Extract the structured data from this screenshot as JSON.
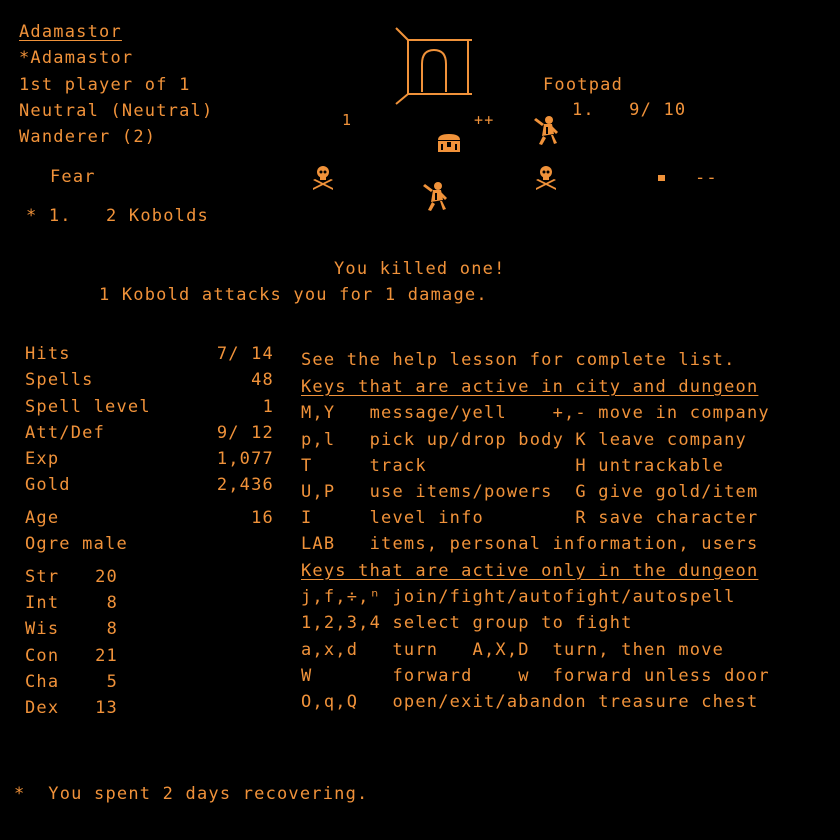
{
  "colors": {
    "text": "#f0923a",
    "background": "#000000"
  },
  "character": {
    "name": "Adamastor",
    "title": "*Adamastor",
    "player": "1st player of 1",
    "alignment": "Neutral (Neutral)",
    "class": "Wanderer (2)",
    "condition": "Fear"
  },
  "group": {
    "line": "* 1.   2 Kobolds"
  },
  "view": {
    "monster_name": "Footpad",
    "monster_count": "1.   9/ 10",
    "marker_one": "1",
    "marker_plus": "++",
    "marker_dash": "--",
    "icons": [
      "archway-door-icon",
      "treasure-chest-icon",
      "kobold-icon",
      "skull-crossbones-icon",
      "skull-crossbones-icon",
      "kobold-icon",
      "compass-marker-icon"
    ]
  },
  "messages": {
    "line1": "You killed one!",
    "line2": "1 Kobold attacks you for 1 damage.",
    "footer": "*  You spent 2 days recovering."
  },
  "stats": {
    "rows": [
      {
        "label": "Hits",
        "value": "7/ 14"
      },
      {
        "label": "Spells",
        "value": "48"
      },
      {
        "label": "Spell level",
        "value": "1"
      },
      {
        "label": "Att/Def",
        "value": "9/ 12"
      },
      {
        "label": "Exp",
        "value": "1,077"
      },
      {
        "label": "Gold",
        "value": "2,436"
      },
      {
        "label": "Age",
        "value": "16"
      }
    ],
    "race": "Ogre male",
    "attributes": [
      {
        "label": "Str",
        "value": "20"
      },
      {
        "label": "Int",
        "value": "8"
      },
      {
        "label": "Wis",
        "value": "8"
      },
      {
        "label": "Con",
        "value": "21"
      },
      {
        "label": "Cha",
        "value": "5"
      },
      {
        "label": "Dex",
        "value": "13"
      }
    ]
  },
  "help": {
    "intro": "See the help lesson for complete list.",
    "heading_city": "Keys that are active in city and dungeon",
    "city_lines": [
      "M,Y   message/yell    +,- move in company",
      "p,l   pick up/drop body K leave company",
      "T     track             H untrackable",
      "U,P   use items/powers  G give gold/item",
      "I     level info        R save character",
      "LAB   items, personal information, users"
    ],
    "heading_dungeon": "Keys that are active only in the dungeon",
    "dungeon_lines": [
      "j,f,÷,ⁿ join/fight/autofight/autospell",
      "1,2,3,4 select group to fight",
      "a,x,d   turn   A,X,D  turn, then move",
      "W       forward    w  forward unless door",
      "O,q,Q   open/exit/abandon treasure chest"
    ]
  }
}
